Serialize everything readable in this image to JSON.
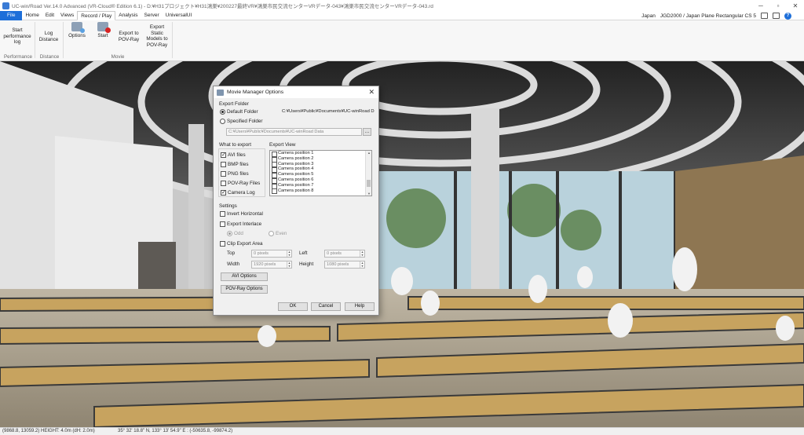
{
  "window": {
    "title": "UC-win/Road Ver.14.0 Advanced (VR-Cloud® Edition 6.1) - D:¥H31プロジェクト¥H31鴻巣¥200227最終VR¥鴻巣市民交流センターVRデータ-043¥鴻巣市民交流センターVRデータ-043.rd",
    "minimize": "─",
    "maximize": "▫",
    "close": "✕"
  },
  "menu": {
    "file": "File",
    "tabs": [
      "Home",
      "Edit",
      "Views",
      "Record / Play",
      "Analysis",
      "Server",
      "UniversalUI"
    ],
    "active_tab": "Record / Play",
    "country": "Japan",
    "coord_system": "JGD2000 / Japan Plane Rectangular CS 5",
    "help": "?"
  },
  "ribbon": {
    "start_performance_log": "Start performance log",
    "log_distance": "Log Distance",
    "options": "Options",
    "start": "Start",
    "export_pov_ray": "Export to POV-Ray",
    "export_static_models": "Export Static Models to POV-Ray",
    "groups": {
      "performance": "Performance",
      "distance": "Distance",
      "movie": "Movie"
    }
  },
  "status": {
    "position": "(9868.8, 13059.2)  HEIGHT: 4.0m (dH: 2.0m)",
    "latlon": "35° 32' 18.8\" N, 133° 13' 54.9\" E  :  (-50635.8, -99874.2)"
  },
  "dialog": {
    "title": "Movie Manager Options",
    "close": "✕",
    "export_folder": {
      "label": "Export Folder",
      "default_label": "Default Folder",
      "default_path": "C:¥Users¥Public¥Documents¥UC-winRoad Da",
      "specified_label": "Specified Folder",
      "specified_path": "C:¥Users¥Public¥Documents¥UC-winRoad Data",
      "browse": "…",
      "selected": "default"
    },
    "what_to_export": {
      "label": "What to export",
      "items": [
        {
          "label": "AVI files",
          "checked": true
        },
        {
          "label": "BMP files",
          "checked": false
        },
        {
          "label": "PNG files",
          "checked": false
        },
        {
          "label": "POV-Ray Files",
          "checked": false
        },
        {
          "label": "Camera Log",
          "checked": true
        }
      ]
    },
    "export_view": {
      "label": "Export View",
      "items": [
        "Camera position 1",
        "Camera position 2",
        "Camera position 3",
        "Camera position 4",
        "Camera position 5",
        "Camera position 6",
        "Camera position 7",
        "Camera position 8"
      ]
    },
    "settings": {
      "label": "Settings",
      "invert_horizontal": "Invert Horizontal",
      "export_interlace": "Export Interlace",
      "odd": "Odd",
      "even": "Even",
      "clip_export_area": "Clip Export Area",
      "top_label": "Top",
      "top_value": "0 pixels",
      "left_label": "Left",
      "left_value": "0 pixels",
      "width_label": "Width",
      "width_value": "1920 pixels",
      "height_label": "Height",
      "height_value": "1080 pixels"
    },
    "buttons": {
      "avi_options": "AVI Options",
      "povray_options": "POV-Ray Options",
      "ok": "OK",
      "cancel": "Cancel",
      "help": "Help"
    }
  }
}
